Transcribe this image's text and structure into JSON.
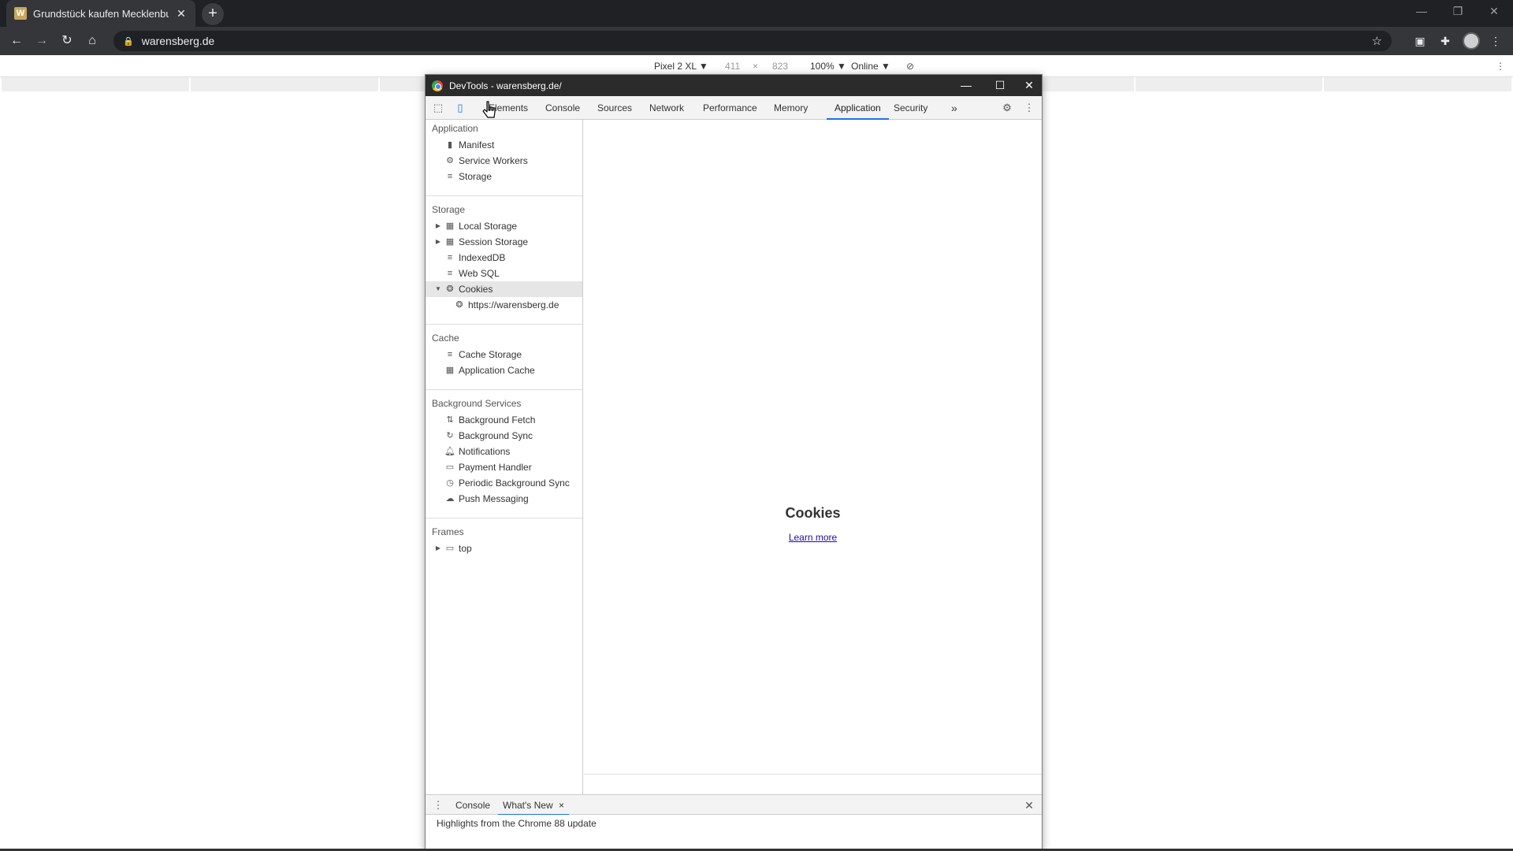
{
  "browser": {
    "tab_title": "Grundstück kaufen Mecklenburg",
    "favicon_letter": "W",
    "url": "warensberg.de"
  },
  "device_toolbar": {
    "device": "Pixel 2 XL ▼",
    "width": "411",
    "times": "×",
    "height": "823",
    "zoom": "100% ▼",
    "network": "Online ▼"
  },
  "devtools": {
    "window_title": "DevTools - warensberg.de/",
    "tabs": [
      "Elements",
      "Console",
      "Sources",
      "Network",
      "Performance",
      "Memory",
      "Application",
      "Security"
    ],
    "active_tab": "Application",
    "more_tabs": "»",
    "sidebar": {
      "sections": [
        {
          "title": "Application",
          "items": [
            {
              "label": "Manifest",
              "icon": "document-icon"
            },
            {
              "label": "Service Workers",
              "icon": "gear-icon"
            },
            {
              "label": "Storage",
              "icon": "database-icon"
            }
          ]
        },
        {
          "title": "Storage",
          "items": [
            {
              "label": "Local Storage",
              "icon": "grid-icon",
              "expandable": true
            },
            {
              "label": "Session Storage",
              "icon": "grid-icon",
              "expandable": true
            },
            {
              "label": "IndexedDB",
              "icon": "database-icon"
            },
            {
              "label": "Web SQL",
              "icon": "database-icon"
            },
            {
              "label": "Cookies",
              "icon": "cookie-icon",
              "expanded": true,
              "selected": true
            },
            {
              "label": "https://warensberg.de",
              "icon": "cookie-icon",
              "child": true
            }
          ]
        },
        {
          "title": "Cache",
          "items": [
            {
              "label": "Cache Storage",
              "icon": "database-icon"
            },
            {
              "label": "Application Cache",
              "icon": "grid-icon"
            }
          ]
        },
        {
          "title": "Background Services",
          "items": [
            {
              "label": "Background Fetch",
              "icon": "updown-arrows-icon"
            },
            {
              "label": "Background Sync",
              "icon": "sync-icon"
            },
            {
              "label": "Notifications",
              "icon": "bell-icon"
            },
            {
              "label": "Payment Handler",
              "icon": "card-icon"
            },
            {
              "label": "Periodic Background Sync",
              "icon": "clock-icon"
            },
            {
              "label": "Push Messaging",
              "icon": "cloud-icon"
            }
          ]
        },
        {
          "title": "Frames",
          "items": [
            {
              "label": "top",
              "icon": "frame-icon",
              "expandable": true
            }
          ]
        }
      ]
    },
    "main": {
      "heading": "Cookies",
      "link": "Learn more"
    },
    "drawer": {
      "tabs": [
        "Console",
        "What's New"
      ],
      "active_tab": "What's New",
      "close_tab": "×",
      "content": "Highlights from the Chrome 88 update"
    }
  }
}
